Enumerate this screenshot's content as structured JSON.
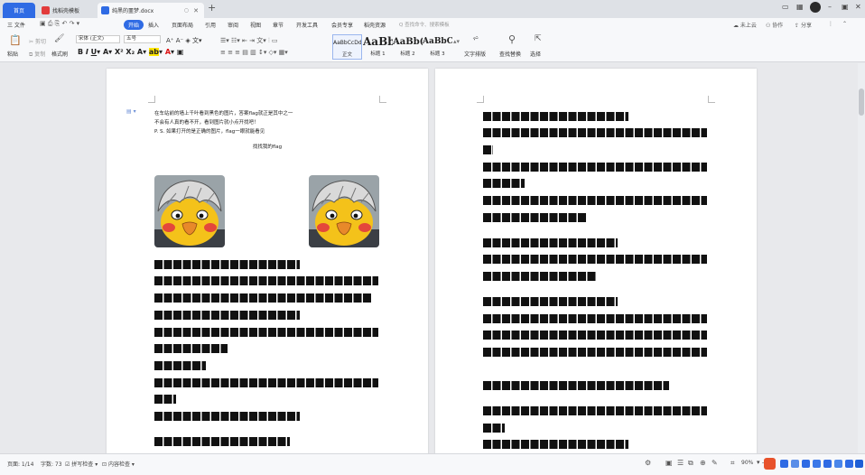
{
  "tabs": {
    "home": "首页",
    "wps": "找稻壳模板",
    "doc": "纯黑的噩梦.docx"
  },
  "menu": {
    "file": "三 文件",
    "items": [
      "开始",
      "插入",
      "页面布局",
      "引用",
      "审阅",
      "视图",
      "章节",
      "开发工具",
      "会员专享",
      "稻壳资源"
    ],
    "search_placeholder": "Q 查找命令、搜索模板",
    "right": [
      "未上云",
      "协作",
      "分享"
    ]
  },
  "ribbon": {
    "paste": "粘贴",
    "cut": "剪切",
    "copy": "复制",
    "format_painter": "格式刷",
    "font_name": "宋体 (正文)",
    "font_size": "五号",
    "styles": [
      {
        "sample": "AaBbCcDd",
        "name": "正文"
      },
      {
        "sample": "AaBb",
        "name": "标题 1"
      },
      {
        "sample": "AaBb(",
        "name": "标题 2"
      },
      {
        "sample": "AaBbC",
        "name": "标题 3"
      }
    ],
    "text_layout": "文字排版",
    "find_replace": "查找替换",
    "select": "选择"
  },
  "document": {
    "line1": "在车站前的墙上千叶看到黑色的图片，答案flag就正是其中之一",
    "line2": "不会有人真的看不开，看到图片就小点开找吧！",
    "line3": "P. S. 如果打开的是正确的图片，flag一眼就能看见",
    "heading": "找找我的flag"
  },
  "status": {
    "page": "页面: 1/14",
    "words": "字数: 73",
    "spell": "拼写检查",
    "content_check": "内容检查",
    "zoom": "90%"
  }
}
